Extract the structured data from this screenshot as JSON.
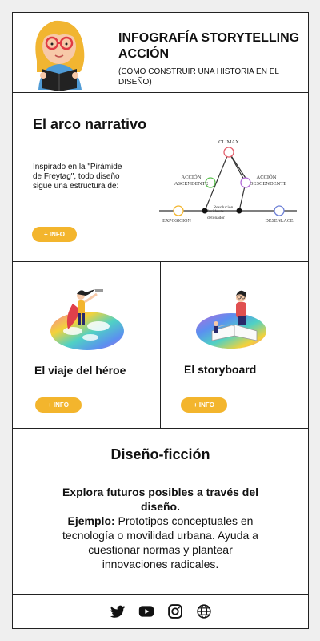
{
  "header": {
    "title": "INFOGRAFÍA STORYTELLING ACCIÓN",
    "subtitle": "(CÓMO CONSTRUIR UNA HISTORIA EN EL DISEÑO)",
    "logo_icon": "girl-reading-book-icon"
  },
  "arc_section": {
    "title": "El arco narrativo",
    "description": "Inspirado en la \"Pirámide de Freytag\", todo diseño sigue una estructura de:",
    "button_label": "+ INFO",
    "diagram": {
      "climax": "CLÍMAX",
      "rising_line1": "ACCIÓN",
      "rising_line2": "ASCENDENTE",
      "falling_line1": "ACCIÓN",
      "falling_line2": "DESCENDENTE",
      "incident_line1": "Incidente",
      "incident_line2": "detonador",
      "resolution": "Resolución",
      "exposition": "EXPOSICIÓN",
      "denouement": "DESENLACE",
      "colors": {
        "climax": "#e4606d",
        "rising": "#5cc150",
        "falling": "#b36ad8",
        "exposition": "#f3b52d",
        "denouement": "#6c7fd6"
      }
    }
  },
  "hero_card": {
    "title": "El viaje del héroe",
    "button_label": "+ INFO",
    "illustration_icon": "hero-on-rainbow-island-icon"
  },
  "storyboard_card": {
    "title": "El storyboard",
    "button_label": "+ INFO",
    "illustration_icon": "open-book-rainbow-island-icon"
  },
  "fiction_section": {
    "title": "Diseño-ficción",
    "lead": "Explora futuros posibles a través del diseño.",
    "example_label": "Ejemplo:",
    "example_text": " Prototipos conceptuales en tecnología o movilidad urbana. Ayuda a cuestionar normas y plantear innovaciones radicales."
  },
  "footer": {
    "icons": [
      "twitter-icon",
      "youtube-icon",
      "instagram-icon",
      "globe-icon"
    ]
  },
  "brand": {
    "accent": "#f3b52d"
  }
}
